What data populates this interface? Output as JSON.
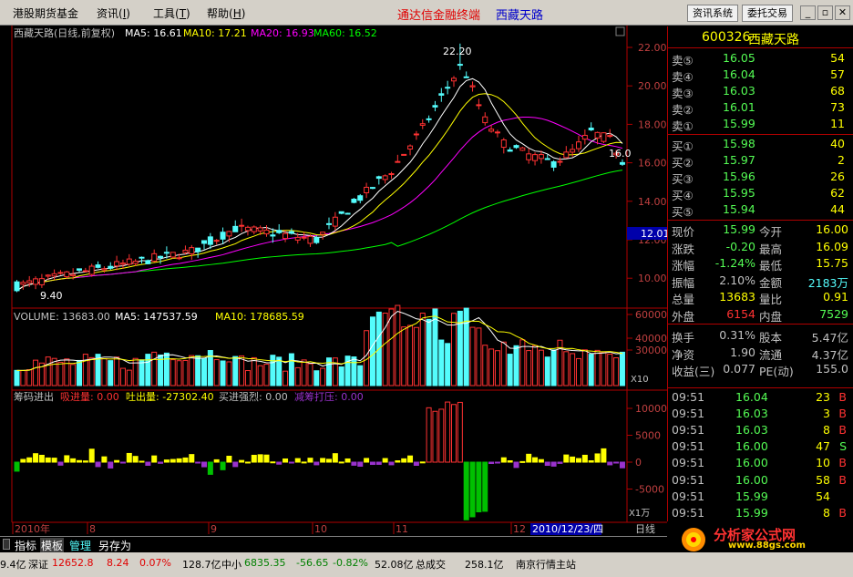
{
  "menu": {
    "items": [
      "港股期货基金",
      "资讯",
      "工具",
      "帮助"
    ],
    "brand": "通达信金融终端",
    "brand_stock": "西藏天路",
    "btn_info": "资讯系统",
    "btn_trade": "委托交易"
  },
  "main": {
    "title": "西藏天路(日线,前复权)",
    "ma5": "MA5: 16.61",
    "ma10": "MA10: 17.21",
    "ma20": "MA20: 16.93",
    "ma60": "MA60: 16.52",
    "high_label": "22.20",
    "low_label": "9.40",
    "last_label": "16.0",
    "cursor_price": "12.01",
    "price_ticks": [
      "22.00",
      "20.00",
      "18.00",
      "16.00",
      "14.00",
      "12.00",
      "10.00"
    ]
  },
  "vol": {
    "title": "VOLUME: 13683.00",
    "ma5": "MA5: 147537.59",
    "ma10": "MA10: 178685.59",
    "ticks": [
      "60000",
      "40000",
      "30000"
    ],
    "unit": "X10"
  },
  "chip": {
    "title": "筹码进出",
    "in_label": "吸进量: 0.00",
    "out_label": "吐出量: -27302.40",
    "strong_label": "买进强烈: 0.00",
    "press_label": "减筹打压: 0.00",
    "ticks": [
      "10000",
      "5000",
      "0",
      "-5000"
    ],
    "unit": "X1万"
  },
  "timeaxis": {
    "labels": [
      "2010年",
      "8",
      "9",
      "10",
      "11",
      "12"
    ],
    "cursor_date": "2010/12/23/四",
    "period": "日线"
  },
  "tabs": [
    "指标",
    "模板",
    "管理",
    "另存为"
  ],
  "quote": {
    "code": "600326",
    "name": "西藏天路",
    "sell": [
      {
        "label": "卖⑤",
        "price": "16.05",
        "vol": "54"
      },
      {
        "label": "卖④",
        "price": "16.04",
        "vol": "57"
      },
      {
        "label": "卖③",
        "price": "16.03",
        "vol": "68"
      },
      {
        "label": "卖②",
        "price": "16.01",
        "vol": "73"
      },
      {
        "label": "卖①",
        "price": "15.99",
        "vol": "11"
      }
    ],
    "buy": [
      {
        "label": "买①",
        "price": "15.98",
        "vol": "40"
      },
      {
        "label": "买②",
        "price": "15.97",
        "vol": "2"
      },
      {
        "label": "买③",
        "price": "15.96",
        "vol": "26"
      },
      {
        "label": "买④",
        "price": "15.95",
        "vol": "62"
      },
      {
        "label": "买⑤",
        "price": "15.94",
        "vol": "44"
      }
    ],
    "stats": [
      {
        "l1": "现价",
        "v1": "15.99",
        "l2": "今开",
        "v2": "16.00"
      },
      {
        "l1": "涨跌",
        "v1": "-0.20",
        "l2": "最高",
        "v2": "16.09"
      },
      {
        "l1": "涨幅",
        "v1": "-1.24%",
        "l2": "最低",
        "v2": "15.75"
      },
      {
        "l1": "振幅",
        "v1": "2.10%",
        "l2": "金额",
        "v2": "2183万"
      },
      {
        "l1": "总量",
        "v1": "13683",
        "l2": "量比",
        "v2": "0.91"
      },
      {
        "l1": "外盘",
        "v1": "6154",
        "l2": "内盘",
        "v2": "7529"
      }
    ],
    "stats2": [
      {
        "l1": "换手",
        "v1": "0.31%",
        "l2": "股本",
        "v2": "5.47亿"
      },
      {
        "l1": "净资",
        "v1": "1.90",
        "l2": "流通",
        "v2": "4.37亿"
      },
      {
        "l1": "收益(三)",
        "v1": "0.077",
        "l2": "PE(动)",
        "v2": "155.0"
      }
    ],
    "ticks": [
      {
        "t": "09:51",
        "p": "16.04",
        "v": "23",
        "d": "B"
      },
      {
        "t": "09:51",
        "p": "16.03",
        "v": "3",
        "d": "B"
      },
      {
        "t": "09:51",
        "p": "16.03",
        "v": "8",
        "d": "B"
      },
      {
        "t": "09:51",
        "p": "16.00",
        "v": "47",
        "d": "S"
      },
      {
        "t": "09:51",
        "p": "16.00",
        "v": "10",
        "d": "B"
      },
      {
        "t": "09:51",
        "p": "16.00",
        "v": "58",
        "d": "B"
      },
      {
        "t": "09:51",
        "p": "15.99",
        "v": "54",
        "d": ""
      },
      {
        "t": "09:51",
        "p": "15.99",
        "v": "8",
        "d": "B"
      }
    ]
  },
  "status": {
    "seg1": "9.4亿",
    "sz_label": "深证",
    "sz_val": "12652.8",
    "sz_chg": "8.24",
    "sz_pct": "0.07%",
    "sz_amt": "128.7亿",
    "zx_label": "中小",
    "zx_val": "6835.35",
    "zx_chg": "-56.65",
    "zx_pct": "-0.82%",
    "zx_amt": "52.08亿",
    "total_label": "总成交",
    "total_val": "258.1亿",
    "site": "南京行情主站"
  },
  "watermark": {
    "text": "分析家公式网",
    "url": "www.88gs.com"
  },
  "colors": {
    "up": "#ff3232",
    "down": "#54fcfc",
    "ma5": "#ffffff",
    "ma10": "#ffff00",
    "ma20": "#ff00ff",
    "ma60": "#00ff00",
    "axis": "#b00000"
  }
}
